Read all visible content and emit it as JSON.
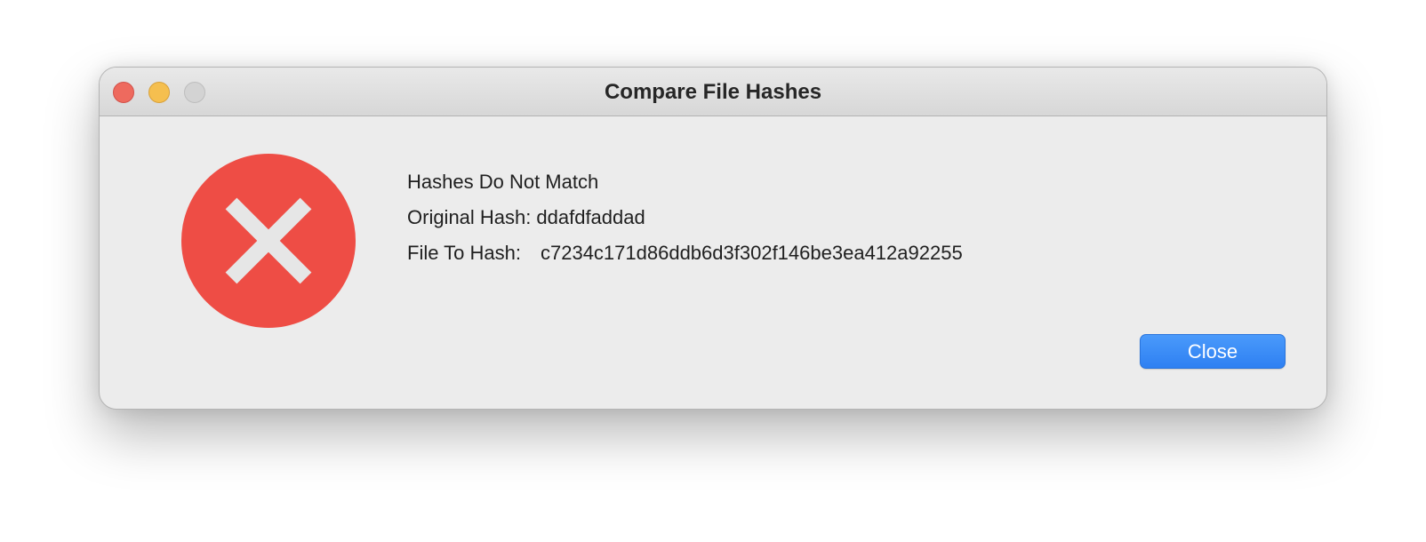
{
  "window": {
    "title": "Compare File Hashes"
  },
  "icons": {
    "status": "error-x-circle-icon",
    "colors": {
      "error_red": "#ee4d45",
      "x_mark": "#e6e6e6"
    }
  },
  "message": {
    "headline": "Hashes Do Not Match",
    "original_hash_label": "Original Hash:",
    "original_hash_value": "ddafdfaddad",
    "file_hash_label": "File To Hash:",
    "file_hash_value": "c7234c171d86ddb6d3f302f146be3ea412a92255"
  },
  "buttons": {
    "close_label": "Close"
  },
  "colors": {
    "accent": "#3a8cf7",
    "window_bg": "#ececec",
    "traffic_close": "#ee6a5e",
    "traffic_minimize": "#f5bf4f",
    "traffic_zoom_disabled": "#d3d3d3"
  }
}
